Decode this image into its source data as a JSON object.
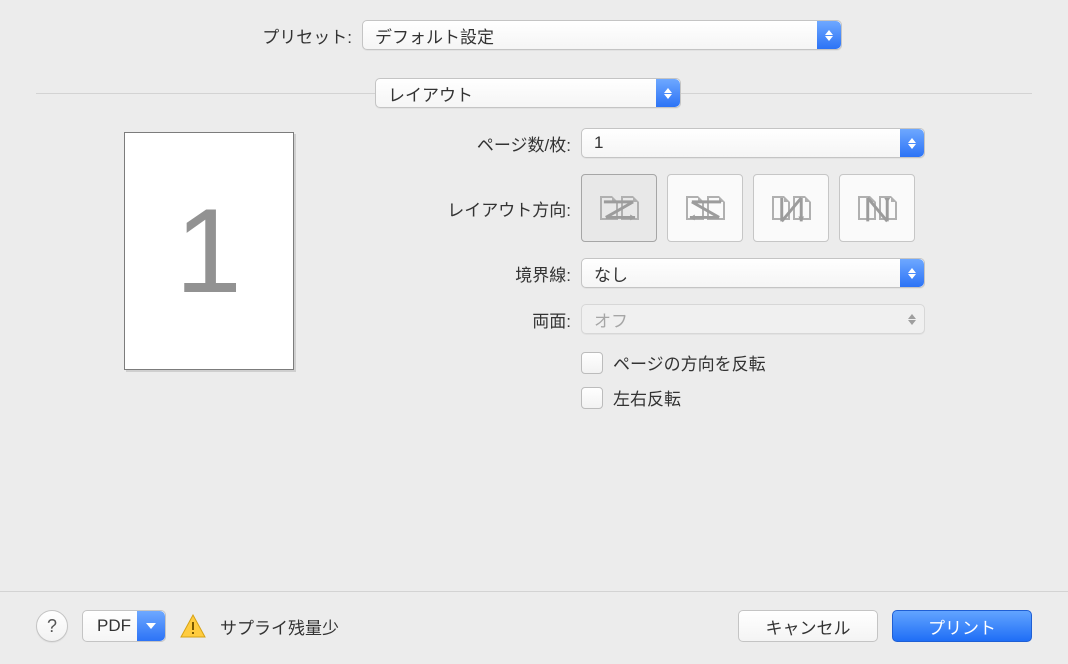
{
  "preset": {
    "label": "プリセット:",
    "value": "デフォルト設定"
  },
  "section": {
    "value": "レイアウト"
  },
  "preview": {
    "page_number": "1"
  },
  "settings": {
    "pages_per_sheet": {
      "label": "ページ数/枚:",
      "value": "1"
    },
    "layout_direction": {
      "label": "レイアウト方向:"
    },
    "border": {
      "label": "境界線:",
      "value": "なし"
    },
    "two_sided": {
      "label": "両面:",
      "value": "オフ"
    },
    "reverse_orientation": {
      "label": "ページの方向を反転"
    },
    "flip_horizontal": {
      "label": "左右反転"
    }
  },
  "bottom": {
    "help": "?",
    "pdf": "PDF",
    "supply": "サプライ残量少",
    "cancel": "キャンセル",
    "print": "プリント"
  }
}
